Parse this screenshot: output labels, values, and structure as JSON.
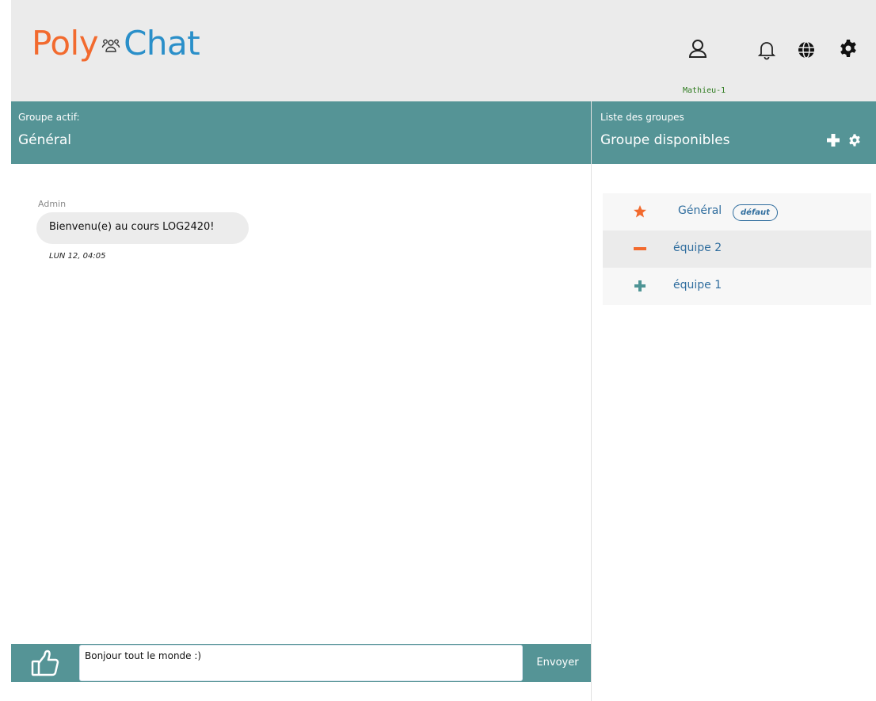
{
  "app": {
    "logo_left": "Poly",
    "logo_right": "Chat",
    "logo_icon": "users-icon"
  },
  "header": {
    "username": "Mathieu-1",
    "icons": [
      "user-icon",
      "bell-icon",
      "globe-icon",
      "gear-icon"
    ]
  },
  "active_group": {
    "label": "Groupe actif:",
    "name": "Général"
  },
  "messages": [
    {
      "author": "Admin",
      "text": "Bienvenu(e) au cours LOG2420!",
      "time": "LUN 12, 04:05"
    }
  ],
  "composer": {
    "value": "Bonjour tout le monde :)",
    "send_label": "Envoyer",
    "like_icon": "thumbs-up-icon"
  },
  "groups_panel": {
    "label": "Liste des groupes",
    "title": "Groupe disponibles",
    "icons": [
      "plus-icon",
      "gear-icon"
    ],
    "groups": [
      {
        "name": "Général",
        "badge": "défaut",
        "icon": "star-icon",
        "icon_color": "#f26a2e"
      },
      {
        "name": "équipe 2",
        "icon": "minus-icon",
        "icon_color": "#f26a2e"
      },
      {
        "name": "équipe 1",
        "icon": "plus-icon",
        "icon_color": "#4e9495"
      }
    ]
  },
  "colors": {
    "teal": "#559496",
    "logo_orange": "#f26a2e",
    "logo_blue": "#2a8fc9",
    "group_link": "#2f6d9e",
    "username_green": "#2c7a1d"
  }
}
